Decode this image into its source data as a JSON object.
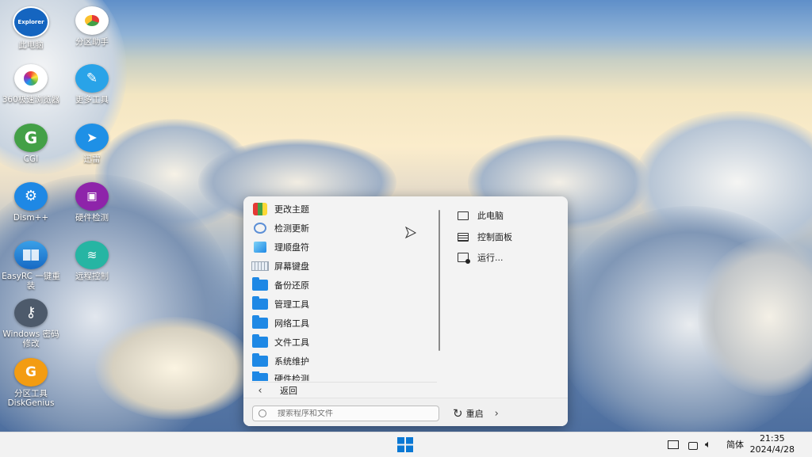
{
  "desktop": {
    "icons": [
      {
        "label": "此电脑",
        "icon_text": "Explorer"
      },
      {
        "label": "分区助手"
      },
      {
        "label": "360极速浏览器"
      },
      {
        "label": "更多工具"
      },
      {
        "label": "CGI",
        "icon_text": "G"
      },
      {
        "label": "迅雷"
      },
      {
        "label": "Dism++"
      },
      {
        "label": "硬件检测"
      },
      {
        "label": "EasyRC 一键重装"
      },
      {
        "label": "远程控制"
      },
      {
        "label": "Windows 密码修改"
      },
      {
        "label": "分区工具DiskGenius",
        "icon_text": "G"
      }
    ]
  },
  "start_menu": {
    "programs": [
      {
        "label": "更改主题"
      },
      {
        "label": "检测更新"
      },
      {
        "label": "理顺盘符"
      },
      {
        "label": "屏幕键盘"
      },
      {
        "label": "备份还原"
      },
      {
        "label": "管理工具"
      },
      {
        "label": "网络工具"
      },
      {
        "label": "文件工具"
      },
      {
        "label": "系统维护"
      },
      {
        "label": "硬件检测"
      }
    ],
    "back_label": "返回",
    "right_items": [
      {
        "label": "此电脑"
      },
      {
        "label": "控制面板"
      },
      {
        "label": "运行..."
      }
    ],
    "search_placeholder": "搜索程序和文件",
    "restart_label": "重启"
  },
  "taskbar": {
    "ime_label": "简体",
    "time": "21:35",
    "date": "2024/4/28"
  },
  "colors": {
    "accent": "#1e88e5",
    "start_logo": "#0a78d4"
  }
}
